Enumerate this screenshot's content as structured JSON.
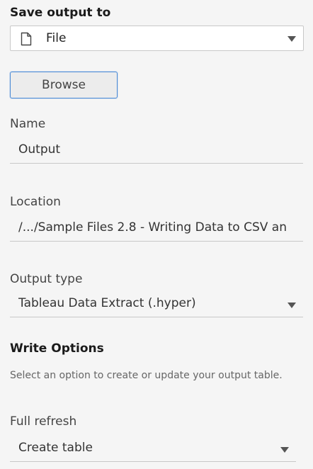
{
  "save_output": {
    "title": "Save output to",
    "selected": "File",
    "icon": "file-icon"
  },
  "browse": {
    "label": "Browse"
  },
  "name": {
    "label": "Name",
    "value": "Output"
  },
  "location": {
    "label": "Location",
    "value": "/.../Sample Files 2.8 - Writing Data to CSV an"
  },
  "output_type": {
    "label": "Output type",
    "selected": "Tableau Data Extract (.hyper)"
  },
  "write_options": {
    "title": "Write Options",
    "hint": "Select an option to create or update your output table."
  },
  "refresh": {
    "label": "Full refresh",
    "selected": "Create table"
  },
  "colors": {
    "accent": "#4c8bd6",
    "background": "#f5f5f5"
  }
}
